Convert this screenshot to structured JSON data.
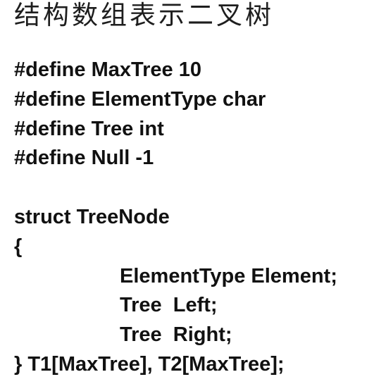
{
  "title": "结构数组表示二叉树",
  "code": {
    "defines": [
      "#define MaxTree 10",
      "#define ElementType char",
      "#define Tree int",
      "#define Null -1"
    ],
    "struct_header": "struct TreeNode",
    "open_brace": "{",
    "fields": [
      "ElementType Element;",
      "Tree  Left;",
      "Tree  Right;"
    ],
    "close_line": "} T1[MaxTree], T2[MaxTree];"
  }
}
